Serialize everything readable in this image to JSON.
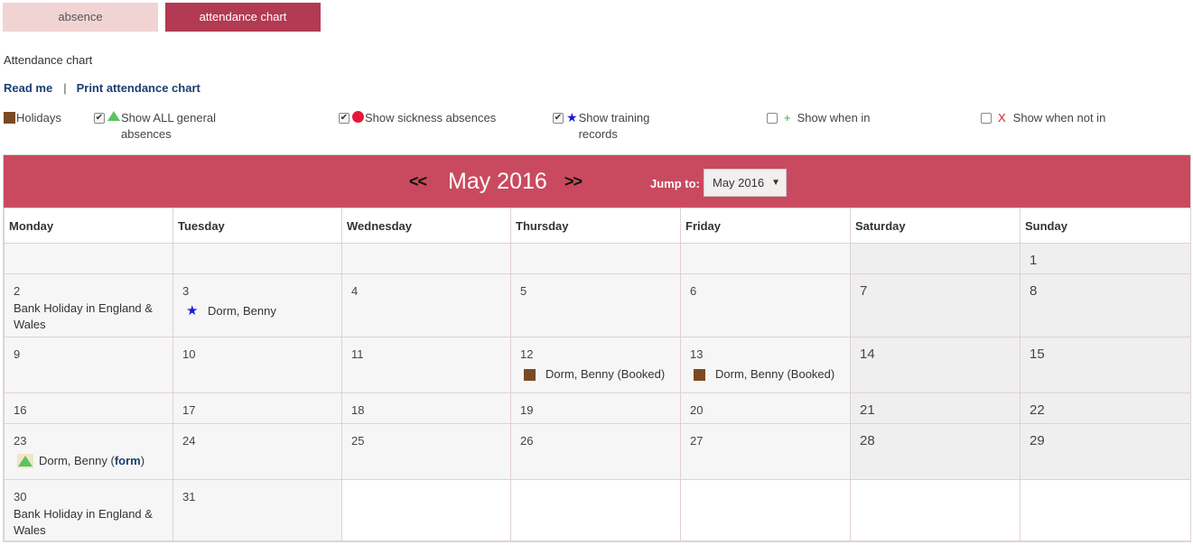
{
  "tabs": {
    "absence": "absence",
    "attendance_chart": "attendance chart"
  },
  "page_heading": "Attendance chart",
  "links": {
    "read_me": "Read me",
    "separator": "|",
    "print": "Print attendance chart"
  },
  "filters": {
    "holidays": "Holidays",
    "general": "Show ALL general absences",
    "general_line1": "Show ALL general",
    "general_line2": "absences",
    "sickness": "Show sickness absences",
    "training_line1": "Show training",
    "training_line2": "records",
    "when_in": "Show when in",
    "when_in_symbol": "+",
    "not_in": "Show when not in",
    "not_in_symbol": "X",
    "checked_mark": "✔"
  },
  "calendar": {
    "prev": "<<",
    "next": ">>",
    "month_title": "May 2016",
    "jump_label": "Jump to:",
    "jump_value": "May 2016",
    "caret": "▼",
    "weekdays": [
      "Monday",
      "Tuesday",
      "Wednesday",
      "Thursday",
      "Friday",
      "Saturday",
      "Sunday"
    ],
    "holiday_name": "Bank Holiday in England & Wales",
    "holiday_line1": "Bank Holiday in England &",
    "holiday_line2": "Wales",
    "entries": {
      "d3": "Dorm, Benny",
      "d12": "Dorm, Benny (Booked)",
      "d13": "Dorm, Benny (Booked)",
      "d23_name": "Dorm, Benny (",
      "d23_link": "form",
      "d23_close": ")"
    },
    "days": {
      "d1": "1",
      "d2": "2",
      "d3": "3",
      "d4": "4",
      "d5": "5",
      "d6": "6",
      "d7": "7",
      "d8": "8",
      "d9": "9",
      "d10": "10",
      "d11": "11",
      "d12": "12",
      "d13": "13",
      "d14": "14",
      "d15": "15",
      "d16": "16",
      "d17": "17",
      "d18": "18",
      "d19": "19",
      "d20": "20",
      "d21": "21",
      "d22": "22",
      "d23": "23",
      "d24": "24",
      "d25": "25",
      "d26": "26",
      "d27": "27",
      "d28": "28",
      "d29": "29",
      "d30": "30",
      "d31": "31"
    }
  },
  "colors": {
    "tab_active": "#b23a52",
    "tab_inactive": "#f2d3d3",
    "calendar_header": "#c94a5e",
    "link": "#1a3e73",
    "holiday": "#7b4a24",
    "general": "#5cc35f",
    "sickness": "#e8173a",
    "training": "#1a1adb"
  },
  "icons": {
    "holiday": "brown-square-icon",
    "general": "green-triangle-icon",
    "sickness": "red-dot-icon",
    "training": "blue-star-icon"
  }
}
